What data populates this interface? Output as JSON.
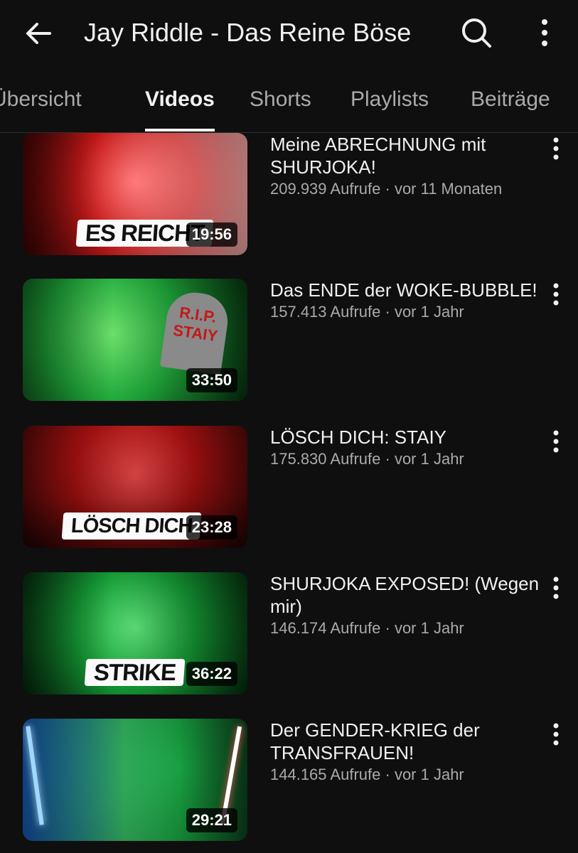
{
  "header": {
    "title": "Jay Riddle - Das Reine Böse",
    "back_icon": "arrow-left-icon",
    "search_icon": "search-icon",
    "more_icon": "more-vertical-icon"
  },
  "tabs": [
    {
      "label": "Übersicht",
      "active": false
    },
    {
      "label": "Videos",
      "active": true
    },
    {
      "label": "Shorts",
      "active": false
    },
    {
      "label": "Playlists",
      "active": false
    },
    {
      "label": "Beiträge",
      "active": false
    }
  ],
  "videos": [
    {
      "title": "Meine ABRECHNUNG mit SHURJOKA!",
      "views": "209.939 Aufrufe",
      "age": "vor 11 Monaten",
      "duration": "19:56",
      "thumb_caption": "ES REICHT"
    },
    {
      "title": "Das ENDE der WOKE-BUBBLE!",
      "views": "157.413 Aufrufe",
      "age": "vor 1 Jahr",
      "duration": "33:50",
      "thumb_caption": "R.I.P. STAIY"
    },
    {
      "title": "LÖSCH DICH: STAIY",
      "views": "175.830 Aufrufe",
      "age": "vor 1 Jahr",
      "duration": "23:28",
      "thumb_caption": "LÖSCH DICH"
    },
    {
      "title": "SHURJOKA EXPOSED! (Wegen mir)",
      "views": "146.174 Aufrufe",
      "age": "vor 1 Jahr",
      "duration": "36:22",
      "thumb_caption": "STRIKE"
    },
    {
      "title": "Der GENDER-KRIEG der TRANSFRAUEN!",
      "views": "144.165 Aufrufe",
      "age": "vor 1 Jahr",
      "duration": "29:21",
      "thumb_caption": ""
    }
  ],
  "meta_separator": "·",
  "colors": {
    "background": "#0f0f0f",
    "text_primary": "#f1f1f1",
    "text_secondary": "#aaaaaa",
    "thumb_red": "#c41818",
    "thumb_green": "#1fa83a"
  }
}
